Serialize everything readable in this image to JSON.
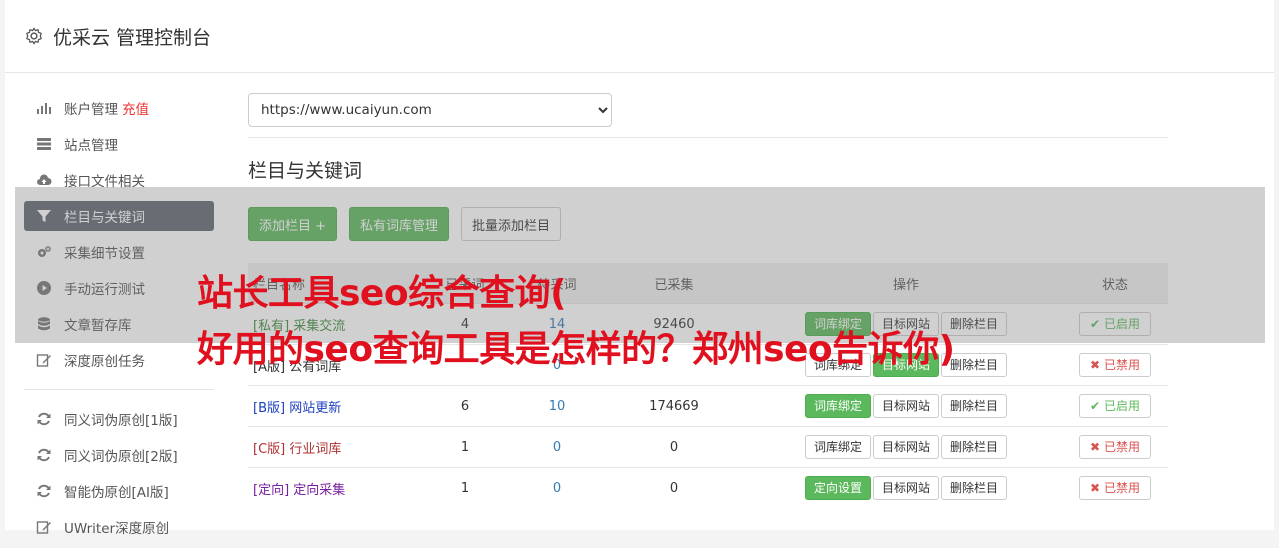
{
  "header": {
    "title": "优采云 管理控制台"
  },
  "sidebar": {
    "items": [
      {
        "label": "账户管理",
        "extra": "充值",
        "icon": "bar-chart-icon"
      },
      {
        "label": "站点管理",
        "icon": "server-icon"
      },
      {
        "label": "接口文件相关",
        "icon": "cloud-upload-icon"
      },
      {
        "label": "栏目与关键词",
        "icon": "filter-icon",
        "active": true
      },
      {
        "label": "采集细节设置",
        "icon": "gears-icon"
      },
      {
        "label": "手动运行测试",
        "icon": "play-circle-icon"
      },
      {
        "label": "文章暂存库",
        "icon": "database-icon"
      },
      {
        "label": "深度原创任务",
        "icon": "edit-icon"
      }
    ],
    "items2": [
      {
        "label": "同义词伪原创[1版]",
        "icon": "refresh-icon"
      },
      {
        "label": "同义词伪原创[2版]",
        "icon": "refresh-icon"
      },
      {
        "label": "智能伪原创[AI版]",
        "icon": "refresh-icon"
      },
      {
        "label": "UWriter深度原创",
        "icon": "edit-icon"
      }
    ]
  },
  "main": {
    "site_select": "https://www.ucaiyun.com",
    "section_title": "栏目与关键词",
    "buttons": {
      "add_column": "添加栏目 +",
      "private_lib": "私有词库管理",
      "batch_add": "批量添加栏目"
    },
    "table": {
      "headers": [
        "栏目名称",
        "已采词",
        "待采词",
        "已采集",
        "操作",
        "状态"
      ],
      "rows": [
        {
          "tag": "[私有]",
          "name": "采集交流",
          "col_a": "4",
          "col_b": "14",
          "collected": "92460",
          "action1": "词库绑定",
          "action1_green": true,
          "action2": "目标网站",
          "action2_green": false,
          "action3": "删除栏目",
          "status": "已启用",
          "enabled": true,
          "color": "#3c8a3c"
        },
        {
          "tag": "[A版]",
          "name": "公有词库",
          "col_a": "",
          "col_b": "0",
          "collected": "",
          "action1": "词库绑定",
          "action1_green": false,
          "action2": "目标网站",
          "action2_green": true,
          "action3": "删除栏目",
          "status": "已禁用",
          "enabled": false,
          "color": "#333333"
        },
        {
          "tag": "[B版]",
          "name": "网站更新",
          "col_a": "6",
          "col_b": "10",
          "collected": "174669",
          "action1": "词库绑定",
          "action1_green": true,
          "action2": "目标网站",
          "action2_green": false,
          "action3": "删除栏目",
          "status": "已启用",
          "enabled": true,
          "color": "#1a3fbf"
        },
        {
          "tag": "[C版]",
          "name": "行业词库",
          "col_a": "1",
          "col_b": "0",
          "collected": "0",
          "action1": "词库绑定",
          "action1_green": false,
          "action2": "目标网站",
          "action2_green": false,
          "action3": "删除栏目",
          "status": "已禁用",
          "enabled": false,
          "color": "#b03030"
        },
        {
          "tag": "[定向]",
          "name": "定向采集",
          "col_a": "1",
          "col_b": "0",
          "collected": "0",
          "action1": "定向设置",
          "action1_green": true,
          "action2": "目标网站",
          "action2_green": false,
          "action3": "删除栏目",
          "status": "已禁用",
          "enabled": false,
          "color": "#7a1fa0"
        }
      ]
    }
  },
  "overlay": {
    "line1": "站长工具seo综合查询(",
    "line2": "好用的seo查询工具是怎样的？郑州seo告诉你)"
  },
  "colors": {
    "accent_green": "#5cb85c",
    "overlay_red": "#e0101f",
    "sidebar_active": "#5f6870"
  }
}
